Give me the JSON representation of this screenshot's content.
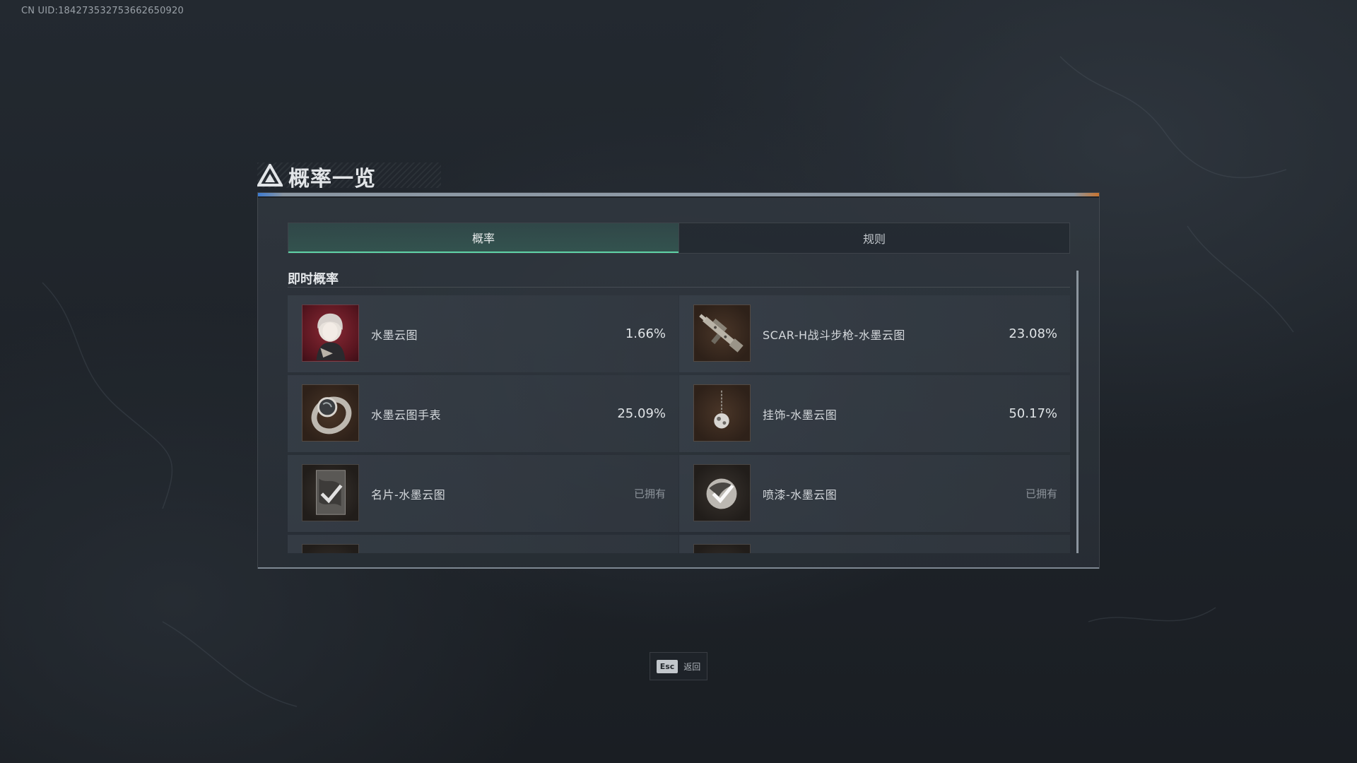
{
  "uid_text": "CN UID:184273532753662650920",
  "header": {
    "title": "概率一览",
    "icon": "triangle-logo-icon"
  },
  "tabs": [
    {
      "label": "概率",
      "active": true
    },
    {
      "label": "规则",
      "active": false
    }
  ],
  "section_title": "即时概率",
  "items": [
    {
      "name": "水墨云图",
      "value": "1.66%",
      "icon": "character-portrait-icon"
    },
    {
      "name": "SCAR-H战斗步枪-水墨云图",
      "value": "23.08%",
      "icon": "rifle-icon"
    },
    {
      "name": "水墨云图手表",
      "value": "25.09%",
      "icon": "watch-icon"
    },
    {
      "name": "挂饰-水墨云图",
      "value": "50.17%",
      "icon": "charm-pendant-icon"
    },
    {
      "name": "名片-水墨云图",
      "value": "已拥有",
      "icon": "name-card-icon",
      "owned": true
    },
    {
      "name": "喷漆-水墨云图",
      "value": "已拥有",
      "icon": "spray-icon",
      "owned": true
    }
  ],
  "footer": {
    "esc_key": "Esc",
    "esc_label": "返回"
  },
  "colors": {
    "accent_green": "#5fd3a7",
    "background": "#1e2329",
    "portrait_red": "#5a1620"
  }
}
